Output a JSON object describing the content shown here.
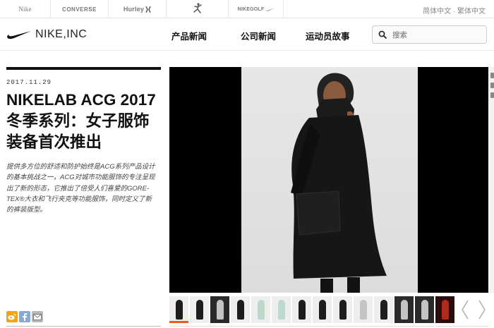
{
  "brand_bar": {
    "brands": [
      "Nike",
      "CONVERSE",
      "Hurley",
      "Jordan",
      "NIKEGOLF"
    ],
    "lang": {
      "simplified": "简体中文",
      "separator": " · ",
      "traditional": "繁体中文"
    }
  },
  "header": {
    "logo_text": "NIKE,INC",
    "nav": [
      "产品新闻",
      "公司新闻",
      "运动员故事"
    ],
    "search": {
      "placeholder": "搜索",
      "value": ""
    }
  },
  "article": {
    "date": "2017.11.29",
    "title": "NIKELAB ACG 2017冬季系列：女子服饰装备首次推出",
    "description": "提供多方位的舒适和防护始终是ACG系列产品设计的基本挑战之一，ACG对城市功能服饰的专注呈现出了新的形态，它推出了倍受人们喜爱的GORE-TEX®大衣和飞行夹克等功能服饰，同时定义了新的裤装版型。",
    "share": [
      "weibo-icon",
      "facebook-icon",
      "mail-icon"
    ]
  },
  "gallery": {
    "hero_icon": "model-in-black-coat",
    "thumb_count": 15,
    "active_index": 0,
    "prev_icon": "chevron-left-icon",
    "next_icon": "chevron-right-icon"
  },
  "colors": {
    "accent": "#f05a1a",
    "hero_bg": "#000000",
    "text": "#111111"
  }
}
